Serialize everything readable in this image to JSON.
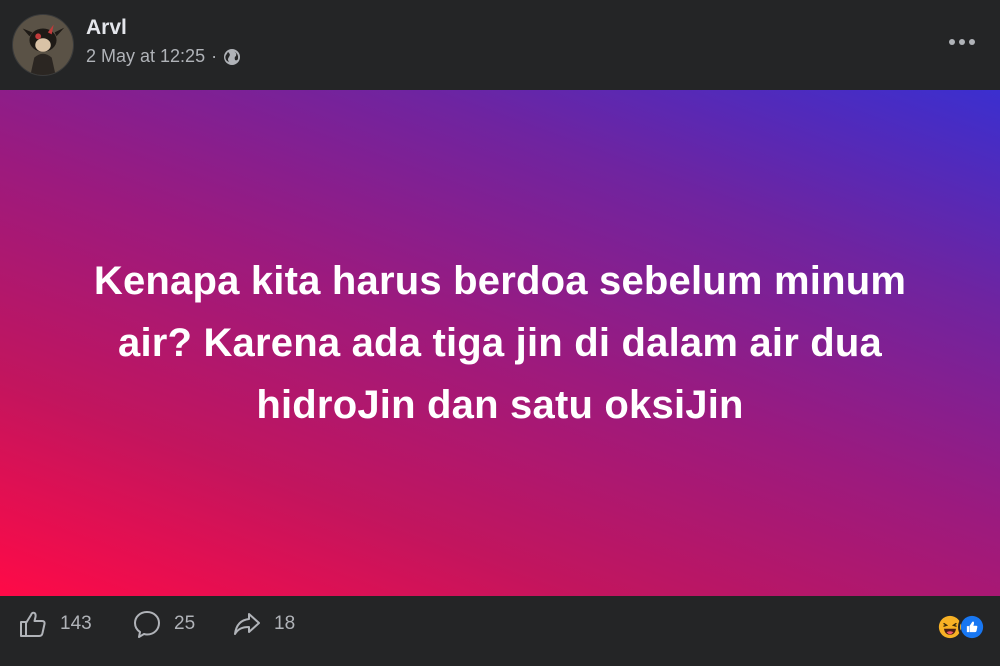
{
  "post": {
    "author": "Arvl",
    "timestamp": "2 May at 12:25",
    "separator": "·",
    "audience_icon": "globe-icon",
    "more_icon": "more-options-icon",
    "text": "Kenapa kita harus berdoa sebelum minum air? Karena ada tiga jin di dalam air dua hidroJin dan satu oksiJin",
    "background_colors": [
      "#ff0a47",
      "#9c1a7e",
      "#3b2fcf"
    ]
  },
  "footer": {
    "like_count": "143",
    "comment_count": "25",
    "share_count": "18",
    "like_icon": "thumbs-up-icon",
    "comment_icon": "comment-bubble-icon",
    "share_icon": "share-arrow-icon",
    "reactions": [
      "haha-emoji-icon",
      "like-reaction-icon"
    ]
  },
  "colors": {
    "panel_bg": "#242526",
    "primary_text": "#e4e6eb",
    "secondary_text": "#b0b3b8",
    "like_blue": "#1877f2",
    "emoji_yellow": "#f7b125"
  }
}
